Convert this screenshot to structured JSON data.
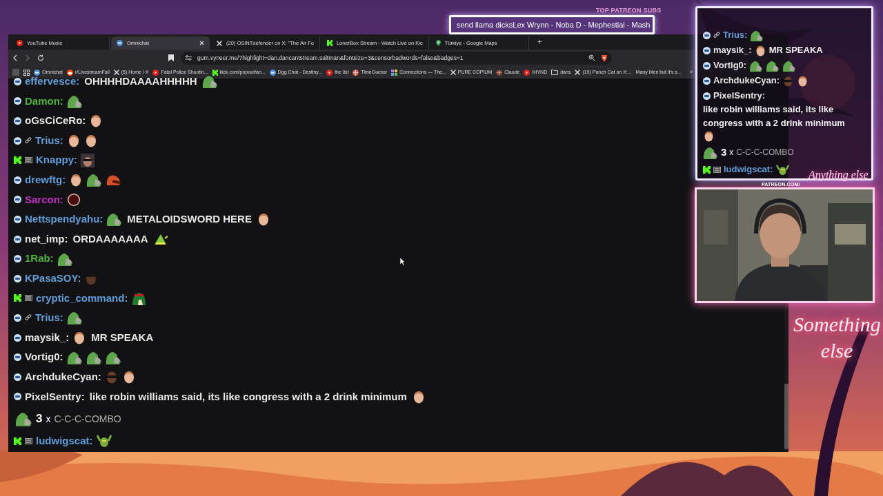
{
  "ticker": {
    "heading": "TOP PATREON SUBS",
    "text": "send llama dicksLex Wrynn -  Noba D - Mephestial - Mash"
  },
  "browser": {
    "tabs": [
      {
        "title": "YouTube Music",
        "selected": false
      },
      {
        "title": "Omnichat",
        "selected": true
      },
      {
        "title": "(20) OSINTdefender on X: \"The Air Fo",
        "selected": false
      },
      {
        "title": "LonerBox Stream - Watch Live on Kic",
        "selected": false
      },
      {
        "title": "Türkiye - Google Maps",
        "selected": false
      }
    ],
    "new_tab": "+",
    "url": "gum.vyneer.me/?highlight=dan.dancantstream.saltman&fontsize=3&censorbadwords=false&badges=1",
    "bookmarks": [
      "Omnichat",
      "r/LivestreamFail",
      "(5) Home / X",
      "Fatal Police Shootin...",
      "kick.com/popout/an...",
      "Dgg Chat - Destiny...",
      "the list",
      "TimeGuessr",
      "Connections — The...",
      "PURE COPIUM",
      "Claude",
      "IHYND",
      "dans",
      "(19) Punch Cat on X:...",
      "Many Men but it's s..."
    ],
    "more_bookmarks": "»"
  },
  "chat": [
    {
      "kind": "dgg",
      "user": "effervesce:",
      "color": "#5f9ed8",
      "parts": [
        {
          "kind": "text",
          "text": "OHHHHDAAAAHHHHH"
        },
        {
          "kind": "frog"
        }
      ]
    },
    {
      "kind": "dgg",
      "user": "Damon:",
      "color": "#4fb33a",
      "parts": [
        {
          "kind": "frog"
        }
      ]
    },
    {
      "kind": "dgg",
      "user": "oGsCiCeRo:",
      "color": "#e8e8e8",
      "parts": [
        {
          "kind": "head"
        }
      ]
    },
    {
      "kind": "dgg_chain",
      "user": "Trius:",
      "color": "#5f9ed8",
      "parts": [
        {
          "kind": "head"
        },
        {
          "kind": "head"
        }
      ]
    },
    {
      "kind": "kick_sub",
      "user": "Knappy:",
      "color": "#5f9ed8",
      "parts": [
        {
          "kind": "portrait"
        }
      ]
    },
    {
      "kind": "dgg",
      "user": "drewftg:",
      "color": "#5f9ed8",
      "parts": [
        {
          "kind": "head"
        },
        {
          "kind": "frog"
        },
        {
          "kind": "angry_frog"
        }
      ]
    },
    {
      "kind": "dgg",
      "user": "Sarcon:",
      "color": "#c02fc0",
      "parts": [
        {
          "kind": "ring"
        }
      ]
    },
    {
      "kind": "dgg",
      "user": "Nettspendyahu:",
      "color": "#5f9ed8",
      "parts": [
        {
          "kind": "frog"
        },
        {
          "kind": "text",
          "text": "METALOIDSWORD HERE"
        },
        {
          "kind": "head"
        }
      ]
    },
    {
      "kind": "dgg",
      "user": "net_imp:",
      "color": "#e8e8e8",
      "parts": [
        {
          "kind": "text",
          "text": "ORDAAAAAAA"
        },
        {
          "kind": "cone"
        }
      ]
    },
    {
      "kind": "dgg",
      "user": "1Rab:",
      "color": "#4fb33a",
      "parts": [
        {
          "kind": "frog"
        }
      ]
    },
    {
      "kind": "dgg",
      "user": "KPasaSOY:",
      "color": "#5f9ed8",
      "parts": [
        {
          "kind": "dark_head"
        }
      ]
    },
    {
      "kind": "kick_sub",
      "user": "cryptic_command:",
      "color": "#5f9ed8",
      "parts": [
        {
          "kind": "hat"
        }
      ]
    },
    {
      "kind": "dgg_chain",
      "user": "Trius:",
      "color": "#5f9ed8",
      "parts": [
        {
          "kind": "frog"
        }
      ]
    },
    {
      "kind": "dgg",
      "user": "maysik_:",
      "color": "#e8e8e8",
      "parts": [
        {
          "kind": "head"
        },
        {
          "kind": "text",
          "text": "MR SPEAKA"
        }
      ]
    },
    {
      "kind": "dgg",
      "user": "Vortig0:",
      "color": "#e8e8e8",
      "parts": [
        {
          "kind": "frog"
        },
        {
          "kind": "frog"
        },
        {
          "kind": "frog"
        }
      ]
    },
    {
      "kind": "dgg",
      "user": "ArchdukeCyan:",
      "color": "#e8e8e8",
      "parts": [
        {
          "kind": "shades_head"
        },
        {
          "kind": "head"
        }
      ]
    },
    {
      "kind": "dgg",
      "user": "PixelSentry:",
      "color": "#e8e8e8",
      "parts": [
        {
          "kind": "text",
          "text": "like robin williams said, its like congress with a 2 drink minimum"
        },
        {
          "kind": "head"
        }
      ]
    }
  ],
  "combo": {
    "count": "3",
    "times": "x",
    "label": "C-C-C-COMBO"
  },
  "last": {
    "kind": "kick_sub",
    "user": "ludwigscat:",
    "color": "#5f9ed8",
    "parts": [
      {
        "kind": "dancer"
      }
    ]
  },
  "overlay_chat": [
    {
      "kind": "dgg_chain",
      "user": "Trius:",
      "color": "#5f9ed8",
      "parts": [
        {
          "kind": "frog"
        }
      ]
    },
    {
      "kind": "dgg",
      "user": "maysik_:",
      "color": "#e8e8e8",
      "parts": [
        {
          "kind": "head"
        },
        {
          "kind": "text",
          "text": "MR SPEAKA"
        }
      ]
    },
    {
      "kind": "dgg",
      "user": "Vortig0:",
      "color": "#e8e8e8",
      "parts": [
        {
          "kind": "frog"
        },
        {
          "kind": "frog"
        },
        {
          "kind": "frog"
        }
      ]
    },
    {
      "kind": "dgg",
      "user": "ArchdukeCyan:",
      "color": "#e8e8e8",
      "parts": [
        {
          "kind": "shades_head"
        },
        {
          "kind": "head"
        }
      ]
    },
    {
      "kind": "dgg",
      "user": "PixelSentry:",
      "color": "#e8e8e8",
      "parts": [
        {
          "kind": "text",
          "text": "like robin williams said, its like congress with a 2 drink minimum"
        },
        {
          "kind": "head"
        }
      ]
    }
  ],
  "overlay_combo": {
    "count": "3",
    "times": "x",
    "label": "C-C-C-COMBO"
  },
  "overlay_last": {
    "kind": "kick_sub",
    "user": "ludwigscat:",
    "color": "#5f9ed8",
    "parts": [
      {
        "kind": "dancer"
      }
    ]
  },
  "branding": {
    "patreon": "PATREON.COM/",
    "patreon_name": "Anything else",
    "logo": "Something else"
  }
}
